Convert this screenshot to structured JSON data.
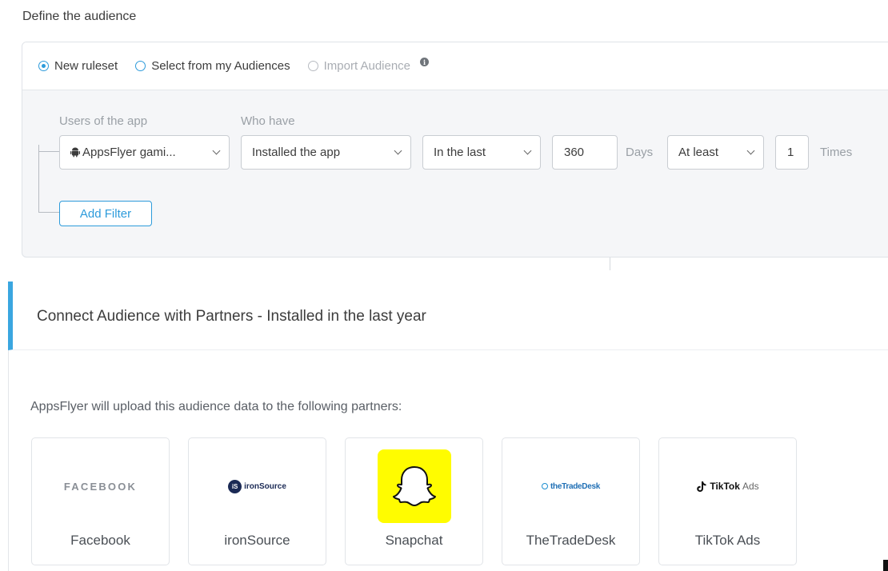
{
  "page": {
    "title": "Define the audience"
  },
  "audience_source": {
    "options": [
      {
        "label": "New ruleset",
        "selected": true,
        "disabled": false
      },
      {
        "label": "Select from my Audiences",
        "selected": false,
        "disabled": false
      },
      {
        "label": "Import Audience",
        "selected": false,
        "disabled": true
      }
    ],
    "info_icon": "info-icon"
  },
  "rule": {
    "app_label": "Users of the app",
    "condition_label": "Who have",
    "app_value": "AppsFlyer gami...",
    "event_value": "Installed the app",
    "period_value": "In the last",
    "days_value": "360",
    "days_unit": "Days",
    "frequency_value": "At least",
    "times_value": "1",
    "times_unit": "Times",
    "add_filter_label": "Add Filter"
  },
  "partners": {
    "header_title": "Connect Audience with Partners - Installed in the last year",
    "description": "AppsFlyer will upload this audience data to the following partners:",
    "items": [
      {
        "name": "Facebook",
        "logo_text": "FACEBOOK"
      },
      {
        "name": "ironSource",
        "logo_text": "ironSource",
        "logo_badge": "iS"
      },
      {
        "name": "Snapchat",
        "logo_text": ""
      },
      {
        "name": "TheTradeDesk",
        "logo_text": "theTradeDesk"
      },
      {
        "name": "TikTok Ads",
        "logo_text": "TikTok",
        "logo_suffix": "Ads"
      }
    ]
  },
  "colors": {
    "accent": "#2d9bdb",
    "snapchat": "#fffc00",
    "panel_bg": "#f5f6f8"
  }
}
